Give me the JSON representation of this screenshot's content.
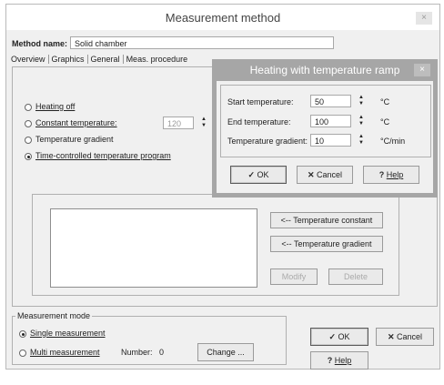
{
  "window": {
    "title": "Measurement method",
    "close_icon": "close-icon"
  },
  "method": {
    "label": "Method name:",
    "value": "Solid chamber"
  },
  "tabs": [
    {
      "label": "Overview"
    },
    {
      "label": "Graphics"
    },
    {
      "label": "General"
    },
    {
      "label": "Meas. procedure"
    }
  ],
  "heating_options": [
    {
      "label": "Heating off",
      "selected": false
    },
    {
      "label": "Constant temperature:",
      "selected": false
    },
    {
      "label": "Temperature gradient",
      "selected": false
    },
    {
      "label": "Time-controlled temperature program",
      "selected": true
    }
  ],
  "constant_temp": {
    "value": "120"
  },
  "program_buttons": {
    "temp_constant": "<-- Temperature constant",
    "temp_gradient": "<-- Temperature gradient",
    "modify": "Modify",
    "delete": "Delete"
  },
  "measurement_mode": {
    "legend": "Measurement mode",
    "single": "Single measurement",
    "multi": "Multi measurement",
    "number_label": "Number:",
    "number_value": "0",
    "change_button": "Change ..."
  },
  "footer_buttons": {
    "ok": "OK",
    "cancel": "Cancel",
    "help": "Help"
  },
  "ramp_dialog": {
    "title": "Heating with temperature ramp",
    "start_label": "Start temperature:",
    "start_value": "50",
    "start_unit": "°C",
    "end_label": "End temperature:",
    "end_value": "100",
    "end_unit": "°C",
    "gradient_label": "Temperature gradient:",
    "gradient_value": "10",
    "gradient_unit": "°C/min",
    "ok": "OK",
    "cancel": "Cancel",
    "help": "Help"
  },
  "glyphs": {
    "check": "✓",
    "x": "✕",
    "q": "?",
    "up": "▲",
    "down": "▼",
    "close": "×"
  }
}
